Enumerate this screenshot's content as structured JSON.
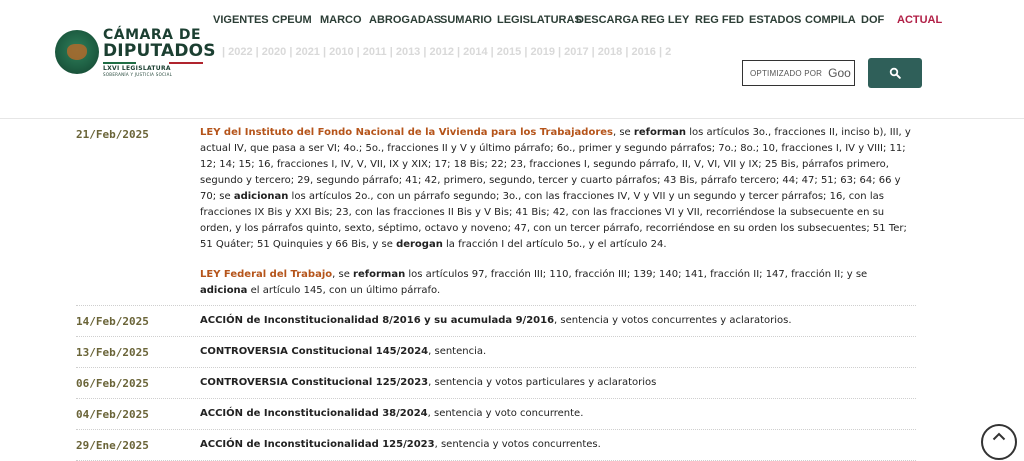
{
  "logo": {
    "line1": "CÁMARA DE",
    "line2": "DIPUTADOS",
    "line3": "LXVI LEGISLATURA",
    "line4": "SOBERANÍA Y JUSTICIA SOCIAL"
  },
  "nav": [
    {
      "label": "VIGENTES"
    },
    {
      "label": "CPEUM"
    },
    {
      "label": "MARCO"
    },
    {
      "label": "ABROGADAS"
    },
    {
      "label": "SUMARIO"
    },
    {
      "label": "LEGISLATURAS"
    },
    {
      "label": "DESCARGA"
    },
    {
      "label": "REG LEY"
    },
    {
      "label": "REG FED"
    },
    {
      "label": "ESTADOS"
    },
    {
      "label": "COMPILA"
    },
    {
      "label": "DOF"
    },
    {
      "label": "ACTUAL"
    }
  ],
  "years_strip": "| 2022 | 2020 | 2021 | 2010 | 2011 | 2013 | 2012 | 2014 | 2015 | 2019 | 2017 | 2018 | 2016 | 2",
  "search": {
    "label": "OPTIMIZADO POR",
    "brand": "Goo"
  },
  "colors": {
    "accent": "#2f5f59",
    "link": "#b5541a",
    "date": "#6a6438",
    "active_nav": "#b11f46"
  },
  "entries": [
    {
      "date": "21/Feb/2025",
      "p1": {
        "law": "LEY del Instituto del Fondo Nacional de la Vivienda para los Trabajadores",
        "t1": ", se ",
        "k1": "reforman",
        "t2": " los artículos 3o., fracciones II, inciso b), III, y actual IV, que pasa a ser VI; 4o.; 5o., fracciones II y V y último párrafo; 6o., primer y segundo párrafos; 7o.; 8o.; 10, fracciones I, IV y VIII; 11; 12; 14; 15; 16, fracciones I, IV, V, VII, IX y XIX; 17; 18 Bis; 22; 23, fracciones I, segundo párrafo, II, V, VI, VII y IX; 25 Bis, párrafos primero, segundo y tercero; 29, segundo párrafo; 41; 42, primero, segundo, tercer y cuarto párrafos; 43 Bis, párrafo tercero; 44; 47; 51; 63; 64; 66 y 70; se ",
        "k2": "adicionan",
        "t3": " los artículos 2o., con un párrafo segundo; 3o., con las fracciones IV, V y VII y un segundo y tercer párrafos; 16, con las fracciones IX Bis y XXI Bis; 23, con las fracciones II Bis y V Bis; 41 Bis; 42, con las fracciones VI y VII, recorriéndose la subsecuente en su orden, y los párrafos quinto, sexto, séptimo, octavo y noveno; 47, con un tercer párrafo, recorriéndose en su orden los subsecuentes; 51 Ter; 51 Quáter; 51 Quinquies y 66 Bis, y se ",
        "k3": "derogan",
        "t4": " la fracción I del artículo 5o., y el artículo 24."
      },
      "p2": {
        "law": "LEY Federal del Trabajo",
        "t1": ", se ",
        "k1": "reforman",
        "t2": " los artículos 97, fracción III; 110, fracción III; 139; 140; 141, fracción II; 147, fracción II; y se ",
        "k2": "adiciona",
        "t3": " el artículo 145, con un último párrafo."
      }
    },
    {
      "date": "14/Feb/2025",
      "title": "ACCIÓN de Inconstitucionalidad 8/2016 y su acumulada 9/2016",
      "desc": ", sentencia y votos concurrentes y aclaratorios."
    },
    {
      "date": "13/Feb/2025",
      "title": "CONTROVERSIA Constitucional 145/2024",
      "desc": ", sentencia."
    },
    {
      "date": "06/Feb/2025",
      "title": "CONTROVERSIA Constitucional 125/2023",
      "desc": ", sentencia y votos particulares y aclaratorios"
    },
    {
      "date": "04/Feb/2025",
      "title": "ACCIÓN de Inconstitucionalidad 38/2024",
      "desc": ", sentencia y voto concurrente."
    },
    {
      "date": "29/Ene/2025",
      "title": "ACCIÓN de Inconstitucionalidad 125/2023",
      "desc": ", sentencia y votos concurrentes."
    }
  ]
}
